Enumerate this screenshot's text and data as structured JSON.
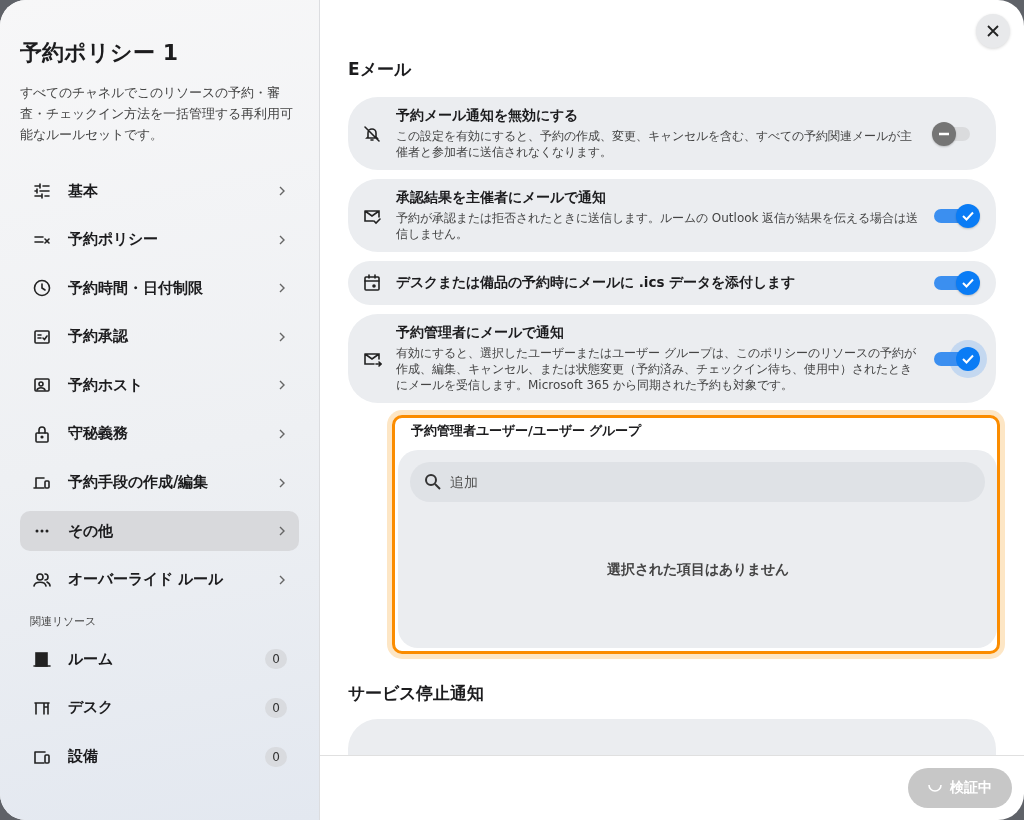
{
  "sidebar": {
    "title": "予約ポリシー 1",
    "description": "すべてのチャネルでこのリソースの予約・審査・チェックイン方法を一括管理する再利用可能なルールセットです。",
    "items": [
      {
        "label": "基本",
        "selected": false
      },
      {
        "label": "予約ポリシー",
        "selected": false
      },
      {
        "label": "予約時間・日付制限",
        "selected": false
      },
      {
        "label": "予約承認",
        "selected": false
      },
      {
        "label": "予約ホスト",
        "selected": false
      },
      {
        "label": "守秘義務",
        "selected": false
      },
      {
        "label": "予約手段の作成/編集",
        "selected": false
      },
      {
        "label": "その他",
        "selected": true
      },
      {
        "label": "オーバーライド ルール",
        "selected": false
      }
    ],
    "related_heading": "関連リソース",
    "related": [
      {
        "label": "ルーム",
        "count": "0"
      },
      {
        "label": "デスク",
        "count": "0"
      },
      {
        "label": "設備",
        "count": "0"
      }
    ]
  },
  "section_title": "Eメール",
  "settings": [
    {
      "title": "予約メール通知を無効にする",
      "description": "この設定を有効にすると、予約の作成、変更、キャンセルを含む、すべての予約関連メールが主催者と参加者に送信されなくなります。",
      "on": false,
      "focused": false
    },
    {
      "title": "承認結果を主催者にメールで通知",
      "description": "予約が承認または拒否されたときに送信します。ルームの Outlook 返信が結果を伝える場合は送信しません。",
      "on": true,
      "focused": false
    },
    {
      "title": "デスクまたは備品の予約時にメールに .ics データを添付します",
      "on": true,
      "focused": false
    },
    {
      "title": "予約管理者にメールで通知",
      "description": "有効にすると、選択したユーザーまたはユーザー グループは、このポリシーのリソースの予約が作成、編集、キャンセル、または状態変更（予約済み、チェックイン待ち、使用中）されたときにメールを受信します。Microsoft 365 から同期された予約も対象です。",
      "on": true,
      "focused": true
    }
  ],
  "managers": {
    "label": "予約管理者ユーザー/ユーザー グループ",
    "placeholder": "追加",
    "empty_text": "選択された項目はありません"
  },
  "section2_title": "サービス停止通知",
  "footer": {
    "button": "検証中",
    "disabled": true
  }
}
